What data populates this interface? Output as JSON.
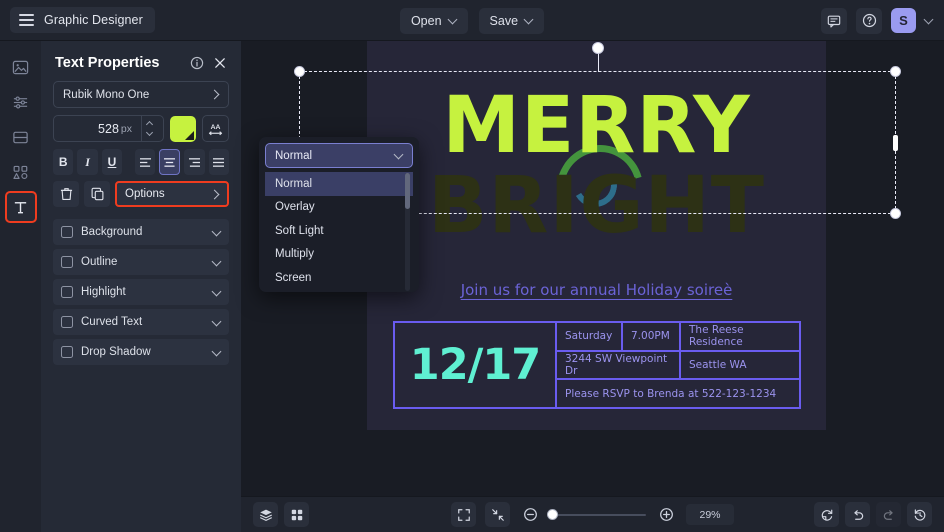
{
  "app": {
    "title": "Graphic Designer",
    "menu_icon": "hamburger-icon"
  },
  "topbar": {
    "open_label": "Open",
    "save_label": "Save",
    "comment_icon": "comment-icon",
    "help_icon": "help-circle-icon",
    "avatar_initial": "S",
    "avatar_color": "#9a9bf0"
  },
  "rail": {
    "items": [
      {
        "name": "image-icon",
        "label": "Image",
        "active": false
      },
      {
        "name": "adjustments-icon",
        "label": "Adjustments",
        "active": false
      },
      {
        "name": "layout-icon",
        "label": "Layout",
        "active": false
      },
      {
        "name": "shapes-icon",
        "label": "Shapes",
        "active": false
      },
      {
        "name": "text-icon",
        "label": "Text",
        "active": true
      }
    ],
    "active_highlight_color": "#ef3c1f"
  },
  "panel": {
    "title": "Text Properties",
    "info_icon": "info-circle-icon",
    "close_icon": "close-icon",
    "font_family": "Rubik Mono One",
    "font_size_value": "528",
    "font_size_unit": "px",
    "color_swatch": "#c6f23f",
    "letter_spacing_icon": "letter-spacing-icon",
    "format_buttons": [
      {
        "name": "bold-button",
        "label": "B",
        "selected": false
      },
      {
        "name": "italic-button",
        "label": "I",
        "selected": false
      },
      {
        "name": "underline-button",
        "label": "U",
        "selected": false
      }
    ],
    "align_buttons": [
      {
        "name": "align-left-button",
        "selected": false
      },
      {
        "name": "align-center-button",
        "selected": true
      },
      {
        "name": "align-right-button",
        "selected": false
      },
      {
        "name": "align-justify-button",
        "selected": false
      }
    ],
    "delete_icon": "trash-icon",
    "duplicate_icon": "duplicate-icon",
    "options_label": "Options",
    "options_highlight_color": "#ef3c1f",
    "accordions": [
      {
        "label": "Background",
        "checked": false
      },
      {
        "label": "Outline",
        "checked": false
      },
      {
        "label": "Highlight",
        "checked": false
      },
      {
        "label": "Curved Text",
        "checked": false
      },
      {
        "label": "Drop Shadow",
        "checked": false
      }
    ]
  },
  "dropdown": {
    "selected": "Normal",
    "options": [
      "Normal",
      "Overlay",
      "Soft Light",
      "Multiply",
      "Screen"
    ],
    "highlighted_index": 0
  },
  "canvas": {
    "background": "#262638",
    "headline_top": "MERRY",
    "headline_top_color": "#c6f23f",
    "headline_bottom": "BRIGHT",
    "headline_bottom_color": "#2d3115",
    "subtitle": "Join us for our annual Holiday soireè",
    "subtitle_color": "#6b63d6",
    "card": {
      "date": "12/17",
      "date_color": "#5ff0d2",
      "border_color": "#6a5cf0",
      "day": "Saturday",
      "time": "7.00PM",
      "venue": "The Reese Residence",
      "address": "3244 SW Viewpoint Dr",
      "city": "Seattle WA",
      "rsvp": "Please RSVP to Brenda at 522-123-1234"
    }
  },
  "bottombar": {
    "layers_icon": "layers-icon",
    "grid_icon": "grid-icon",
    "fit_icon": "fit-screen-icon",
    "shrink_icon": "shrink-icon",
    "zoom_out_icon": "zoom-out-icon",
    "zoom_in_icon": "zoom-in-icon",
    "zoom_level": "29%",
    "reset_icon": "reset-icon",
    "undo_icon": "undo-icon",
    "redo_icon": "redo-icon",
    "history_icon": "history-icon"
  }
}
